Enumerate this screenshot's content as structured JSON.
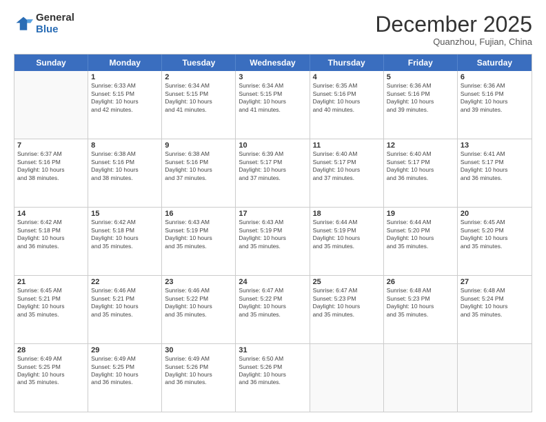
{
  "header": {
    "logo_general": "General",
    "logo_blue": "Blue",
    "month_title": "December 2025",
    "subtitle": "Quanzhou, Fujian, China"
  },
  "calendar": {
    "days_of_week": [
      "Sunday",
      "Monday",
      "Tuesday",
      "Wednesday",
      "Thursday",
      "Friday",
      "Saturday"
    ],
    "rows": [
      [
        {
          "day": "",
          "info": ""
        },
        {
          "day": "1",
          "info": "Sunrise: 6:33 AM\nSunset: 5:15 PM\nDaylight: 10 hours\nand 42 minutes."
        },
        {
          "day": "2",
          "info": "Sunrise: 6:34 AM\nSunset: 5:15 PM\nDaylight: 10 hours\nand 41 minutes."
        },
        {
          "day": "3",
          "info": "Sunrise: 6:34 AM\nSunset: 5:15 PM\nDaylight: 10 hours\nand 41 minutes."
        },
        {
          "day": "4",
          "info": "Sunrise: 6:35 AM\nSunset: 5:16 PM\nDaylight: 10 hours\nand 40 minutes."
        },
        {
          "day": "5",
          "info": "Sunrise: 6:36 AM\nSunset: 5:16 PM\nDaylight: 10 hours\nand 39 minutes."
        },
        {
          "day": "6",
          "info": "Sunrise: 6:36 AM\nSunset: 5:16 PM\nDaylight: 10 hours\nand 39 minutes."
        }
      ],
      [
        {
          "day": "7",
          "info": "Sunrise: 6:37 AM\nSunset: 5:16 PM\nDaylight: 10 hours\nand 38 minutes."
        },
        {
          "day": "8",
          "info": "Sunrise: 6:38 AM\nSunset: 5:16 PM\nDaylight: 10 hours\nand 38 minutes."
        },
        {
          "day": "9",
          "info": "Sunrise: 6:38 AM\nSunset: 5:16 PM\nDaylight: 10 hours\nand 37 minutes."
        },
        {
          "day": "10",
          "info": "Sunrise: 6:39 AM\nSunset: 5:17 PM\nDaylight: 10 hours\nand 37 minutes."
        },
        {
          "day": "11",
          "info": "Sunrise: 6:40 AM\nSunset: 5:17 PM\nDaylight: 10 hours\nand 37 minutes."
        },
        {
          "day": "12",
          "info": "Sunrise: 6:40 AM\nSunset: 5:17 PM\nDaylight: 10 hours\nand 36 minutes."
        },
        {
          "day": "13",
          "info": "Sunrise: 6:41 AM\nSunset: 5:17 PM\nDaylight: 10 hours\nand 36 minutes."
        }
      ],
      [
        {
          "day": "14",
          "info": "Sunrise: 6:42 AM\nSunset: 5:18 PM\nDaylight: 10 hours\nand 36 minutes."
        },
        {
          "day": "15",
          "info": "Sunrise: 6:42 AM\nSunset: 5:18 PM\nDaylight: 10 hours\nand 35 minutes."
        },
        {
          "day": "16",
          "info": "Sunrise: 6:43 AM\nSunset: 5:19 PM\nDaylight: 10 hours\nand 35 minutes."
        },
        {
          "day": "17",
          "info": "Sunrise: 6:43 AM\nSunset: 5:19 PM\nDaylight: 10 hours\nand 35 minutes."
        },
        {
          "day": "18",
          "info": "Sunrise: 6:44 AM\nSunset: 5:19 PM\nDaylight: 10 hours\nand 35 minutes."
        },
        {
          "day": "19",
          "info": "Sunrise: 6:44 AM\nSunset: 5:20 PM\nDaylight: 10 hours\nand 35 minutes."
        },
        {
          "day": "20",
          "info": "Sunrise: 6:45 AM\nSunset: 5:20 PM\nDaylight: 10 hours\nand 35 minutes."
        }
      ],
      [
        {
          "day": "21",
          "info": "Sunrise: 6:45 AM\nSunset: 5:21 PM\nDaylight: 10 hours\nand 35 minutes."
        },
        {
          "day": "22",
          "info": "Sunrise: 6:46 AM\nSunset: 5:21 PM\nDaylight: 10 hours\nand 35 minutes."
        },
        {
          "day": "23",
          "info": "Sunrise: 6:46 AM\nSunset: 5:22 PM\nDaylight: 10 hours\nand 35 minutes."
        },
        {
          "day": "24",
          "info": "Sunrise: 6:47 AM\nSunset: 5:22 PM\nDaylight: 10 hours\nand 35 minutes."
        },
        {
          "day": "25",
          "info": "Sunrise: 6:47 AM\nSunset: 5:23 PM\nDaylight: 10 hours\nand 35 minutes."
        },
        {
          "day": "26",
          "info": "Sunrise: 6:48 AM\nSunset: 5:23 PM\nDaylight: 10 hours\nand 35 minutes."
        },
        {
          "day": "27",
          "info": "Sunrise: 6:48 AM\nSunset: 5:24 PM\nDaylight: 10 hours\nand 35 minutes."
        }
      ],
      [
        {
          "day": "28",
          "info": "Sunrise: 6:49 AM\nSunset: 5:25 PM\nDaylight: 10 hours\nand 35 minutes."
        },
        {
          "day": "29",
          "info": "Sunrise: 6:49 AM\nSunset: 5:25 PM\nDaylight: 10 hours\nand 36 minutes."
        },
        {
          "day": "30",
          "info": "Sunrise: 6:49 AM\nSunset: 5:26 PM\nDaylight: 10 hours\nand 36 minutes."
        },
        {
          "day": "31",
          "info": "Sunrise: 6:50 AM\nSunset: 5:26 PM\nDaylight: 10 hours\nand 36 minutes."
        },
        {
          "day": "",
          "info": ""
        },
        {
          "day": "",
          "info": ""
        },
        {
          "day": "",
          "info": ""
        }
      ]
    ]
  }
}
